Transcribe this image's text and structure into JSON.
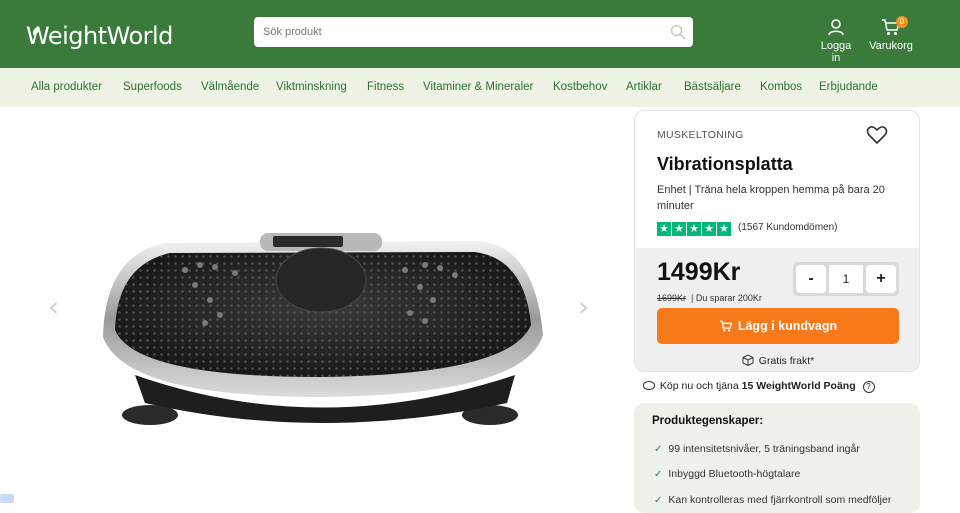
{
  "header": {
    "logo": "WeightWorld",
    "search_placeholder": "Sök produkt",
    "login_label": "Logga in",
    "cart_label": "Varukorg",
    "cart_count": "0"
  },
  "nav": {
    "items": [
      "Alla produkter",
      "Superfoods",
      "Välmående",
      "Viktminskning",
      "Fitness",
      "Vitaminer & Mineraler",
      "Kostbehov",
      "Artiklar",
      "Bästsäljare",
      "Kombos",
      "Erbjudande"
    ]
  },
  "gallery": {
    "prev": "‹",
    "next": "›"
  },
  "product": {
    "category": "MUSKELTONING",
    "title": "Vibrationsplatta",
    "subtitle": "Enhet | Träna hela kroppen hemma på bara 20 minuter",
    "rating_stars": 5,
    "reviews": "(1567 Kundomdömen)",
    "price": "1499Kr",
    "old_price": "1699Kr",
    "savings": "| Du sparar 200Kr",
    "quantity": "1",
    "qty_minus": "-",
    "qty_plus": "+",
    "add_to_cart": "Lägg i kundvagn",
    "shipping": "Gratis frakt*"
  },
  "points": {
    "prefix": "Köp nu och tjäna",
    "value": "15 WeightWorld Poäng",
    "help": "?"
  },
  "properties": {
    "title": "Produktegenskaper:",
    "items": [
      "99 intensitetsnivåer, 5 träningsband ingår",
      "Inbyggd Bluetooth-högtalare",
      "Kan kontrolleras med fjärrkontroll som medföljer"
    ]
  },
  "colors": {
    "brand_green": "#3a7b3c",
    "nav_bg": "#edf3e5",
    "cta_orange": "#f7791a",
    "trustpilot_green": "#00b67a"
  }
}
